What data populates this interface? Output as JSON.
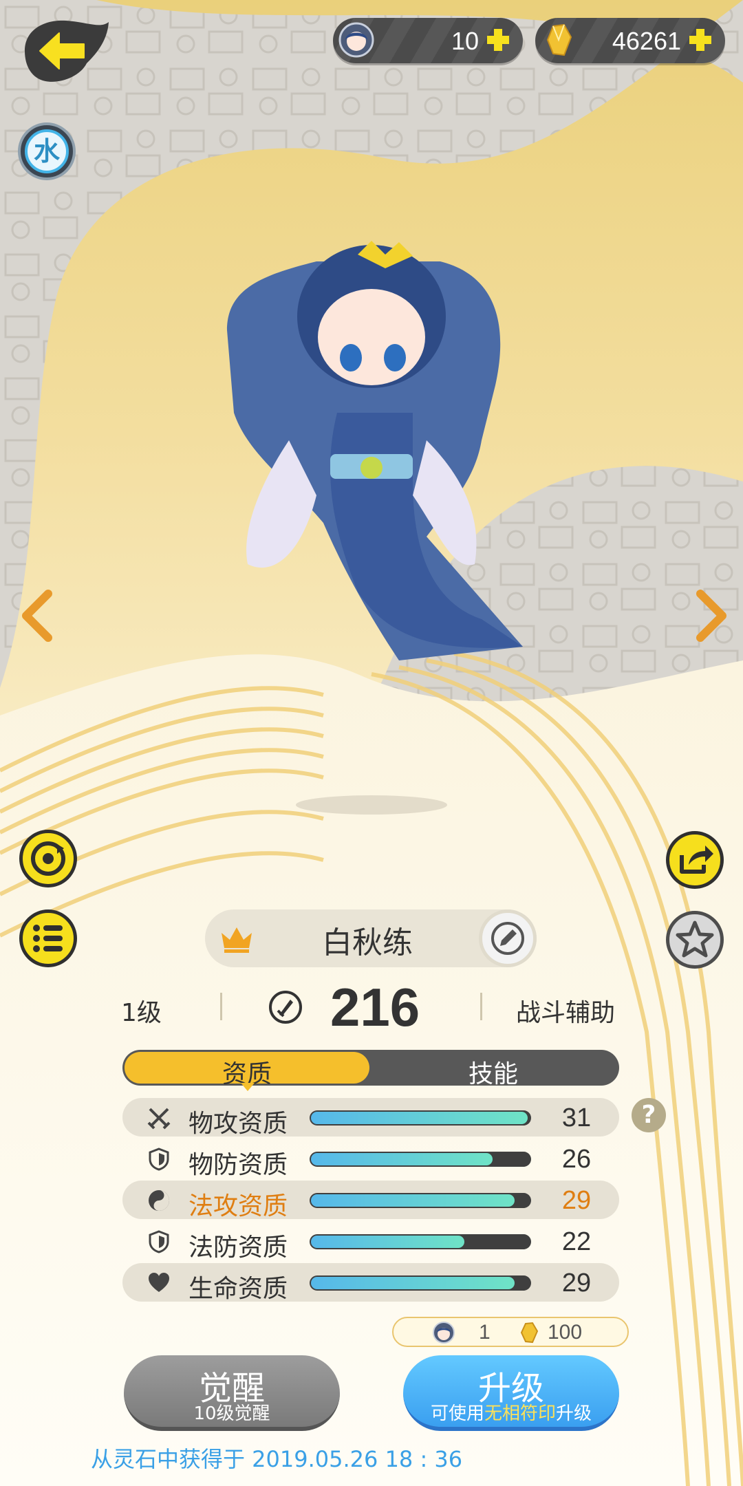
{
  "top_bar": {
    "gem_count": "10",
    "gold_count": "46261"
  },
  "element_badge": "水",
  "character": {
    "name": "白秋练",
    "level": "1级",
    "power": "216",
    "role": "战斗辅助"
  },
  "tabs": [
    {
      "label": "资质",
      "active": true
    },
    {
      "label": "技能",
      "active": false
    }
  ],
  "stats": [
    {
      "label": "物攻资质",
      "value": "31",
      "fill": 0.99,
      "icon": "crossed-swords-icon"
    },
    {
      "label": "物防资质",
      "value": "26",
      "fill": 0.83,
      "icon": "shield-icon"
    },
    {
      "label": "法攻资质",
      "value": "29",
      "fill": 0.93,
      "icon": "yin-yang-icon"
    },
    {
      "label": "法防资质",
      "value": "22",
      "fill": 0.7,
      "icon": "shield-icon"
    },
    {
      "label": "生命资质",
      "value": "29",
      "fill": 0.93,
      "icon": "heart-icon"
    }
  ],
  "cost": {
    "gem_cost": "1",
    "gold_cost": "100"
  },
  "buttons": {
    "awaken_label": "觉醒",
    "awaken_sub": "10级觉醒",
    "upgrade_label": "升级",
    "upgrade_sub_prefix": "可使用",
    "upgrade_sub_item": "无相符印",
    "upgrade_sub_suffix": "升级"
  },
  "footer": {
    "obtained_text": "从灵石中获得于 2019.05.26 18 : 36"
  },
  "help_label": "?",
  "colors": {
    "accent_yellow": "#f5bf2c",
    "highlight_orange": "#df7e12",
    "upgrade_blue": "#3a9ff0",
    "footer_blue": "#3aa0e6"
  }
}
